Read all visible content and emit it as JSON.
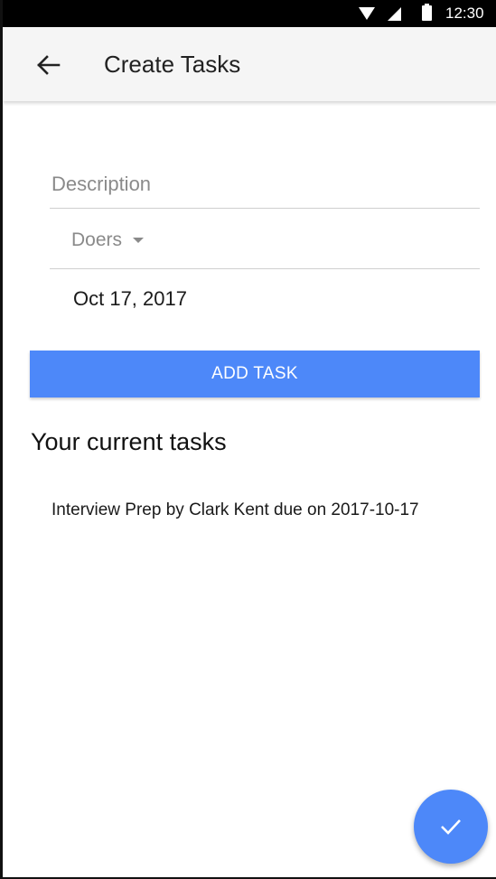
{
  "status_bar": {
    "time": "12:30",
    "icons": [
      "wifi-icon",
      "signal-icon",
      "battery-icon"
    ]
  },
  "app_bar": {
    "back_icon": "arrow-back-icon",
    "title": "Create Tasks"
  },
  "form": {
    "description_placeholder": "Description",
    "description_value": "",
    "doers_label": "Doers",
    "date": "Oct 17, 2017",
    "add_button_label": "ADD TASK"
  },
  "tasks": {
    "heading": "Your current tasks",
    "items": [
      "Interview Prep by Clark Kent due on 2017-10-17"
    ]
  },
  "fab": {
    "icon": "check-icon"
  },
  "colors": {
    "accent": "#4d88f9",
    "app_bar_bg": "#f5f5f5",
    "status_bar_bg": "#000000",
    "hint_text": "#8a8a8a"
  }
}
